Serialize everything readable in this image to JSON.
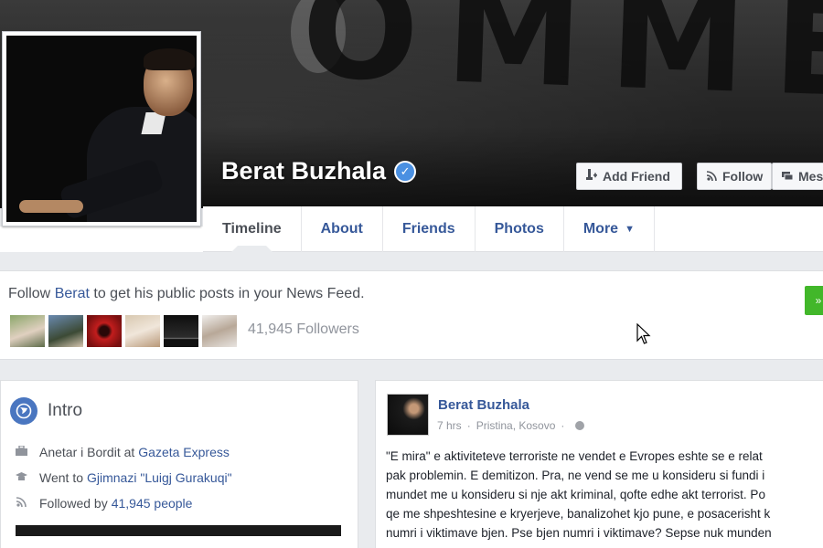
{
  "profile": {
    "name": "Berat Buzhala",
    "verified_glyph": "✓",
    "cover_art_text": "OMMETI"
  },
  "header_buttons": {
    "add_friend": "Add Friend",
    "follow": "Follow",
    "message": "Mess"
  },
  "nav": {
    "tabs": [
      {
        "label": "Timeline",
        "active": true
      },
      {
        "label": "About"
      },
      {
        "label": "Friends"
      },
      {
        "label": "Photos"
      },
      {
        "label": "More"
      }
    ]
  },
  "follow_card": {
    "text_prefix": "Follow ",
    "name": "Berat",
    "text_suffix": " to get his public posts in your News Feed.",
    "followers": "41,945 Followers",
    "button_glyph": "»"
  },
  "intro": {
    "title": "Intro",
    "work_prefix": "Anetar i Bordit at",
    "work_link": "Gazeta Express",
    "edu_prefix": "Went to",
    "edu_link": "Gjimnazi \"Luigj Gurakuqi\"",
    "followed_prefix": "Followed by",
    "followed_link": "41,945 people"
  },
  "post": {
    "author": "Berat Buzhala",
    "time": "7 hrs",
    "location": "Pristina, Kosovo",
    "lines": [
      "\"E mira\" e aktiviteteve terroriste ne vendet e Evropes eshte se e relat",
      "pak problemin. E demitizon. Pra, ne vend se me u konsideru si fundi i",
      "mundet me u konsideru si nje akt kriminal, qofte edhe akt terrorist. Po",
      "qe me shpeshtesine e kryerjeve, banalizohet kjo pune, e posacerisht k",
      "numri i viktimave bjen. Pse bjen numri i viktimave? Sepse nuk munden"
    ]
  },
  "icons": {
    "add_friend": "add-friend-icon",
    "follow": "rss-icon",
    "message": "message-icon",
    "globe": "globe-icon",
    "work": "briefcase-icon",
    "education": "graduation-cap-icon",
    "followed": "rss-icon"
  },
  "colors": {
    "link_blue": "#365899",
    "verified_blue": "#4a90e2",
    "green": "#42b72a",
    "background": "#e9ebee"
  }
}
